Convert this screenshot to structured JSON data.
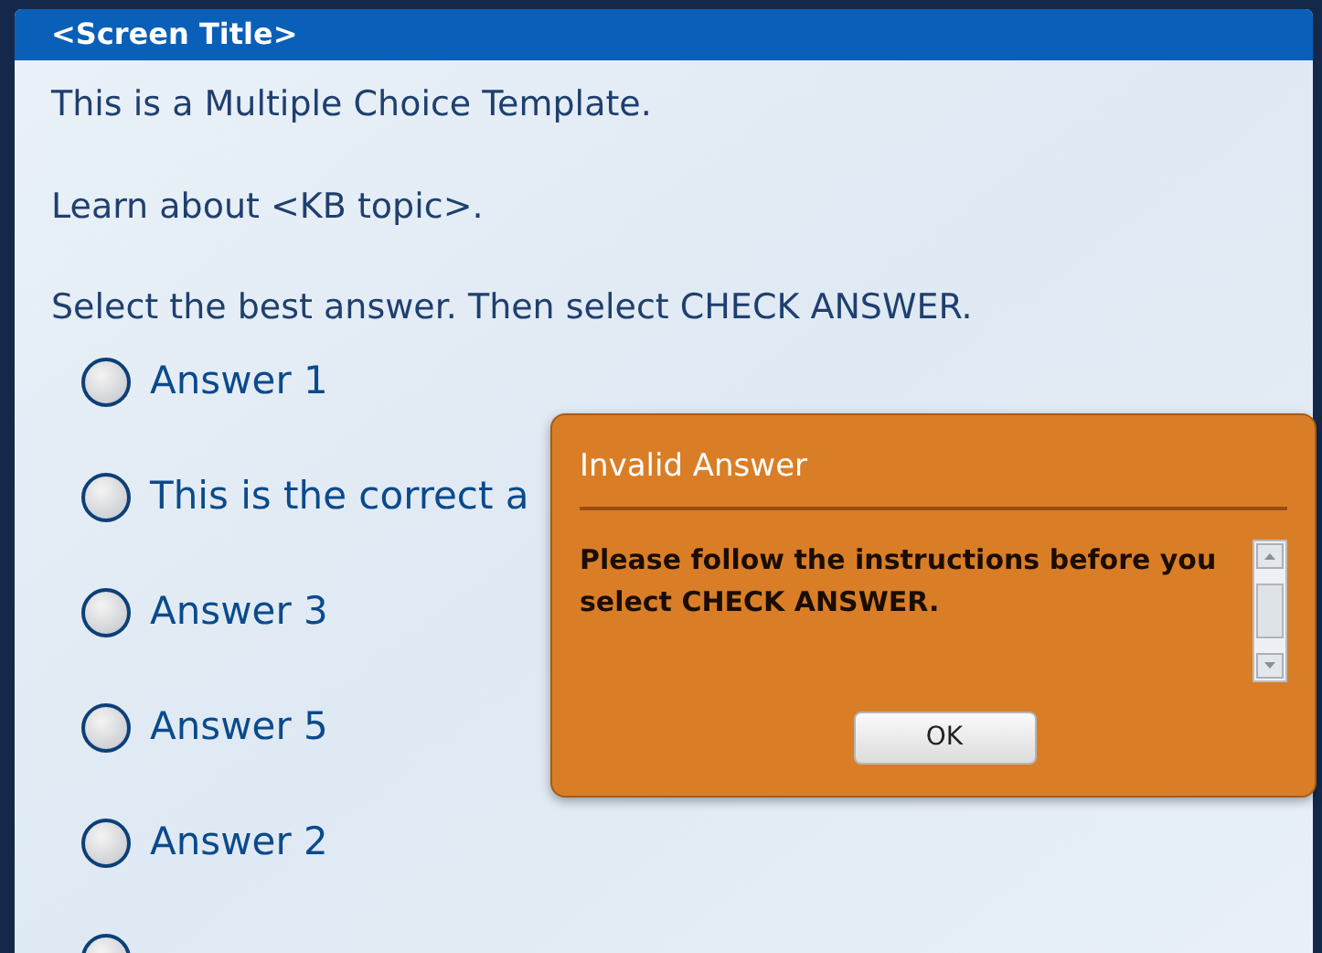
{
  "screen": {
    "title": "<Screen Title>"
  },
  "content": {
    "intro": "This is a Multiple Choice Template.",
    "topic": "Learn about <KB topic>.",
    "instruction": "Select the best answer. Then select CHECK ANSWER."
  },
  "options": [
    {
      "label": "Answer 1",
      "selected": false
    },
    {
      "label": "This is the correct a",
      "selected": false
    },
    {
      "label": "Answer 3",
      "selected": false
    },
    {
      "label": "Answer 5",
      "selected": false
    },
    {
      "label": "Answer 2",
      "selected": false
    },
    {
      "selected": false
    }
  ],
  "dialog": {
    "title": "Invalid Answer",
    "message": "Please follow the instructions before you select CHECK ANSWER.",
    "buttons": [
      "OK"
    ]
  }
}
